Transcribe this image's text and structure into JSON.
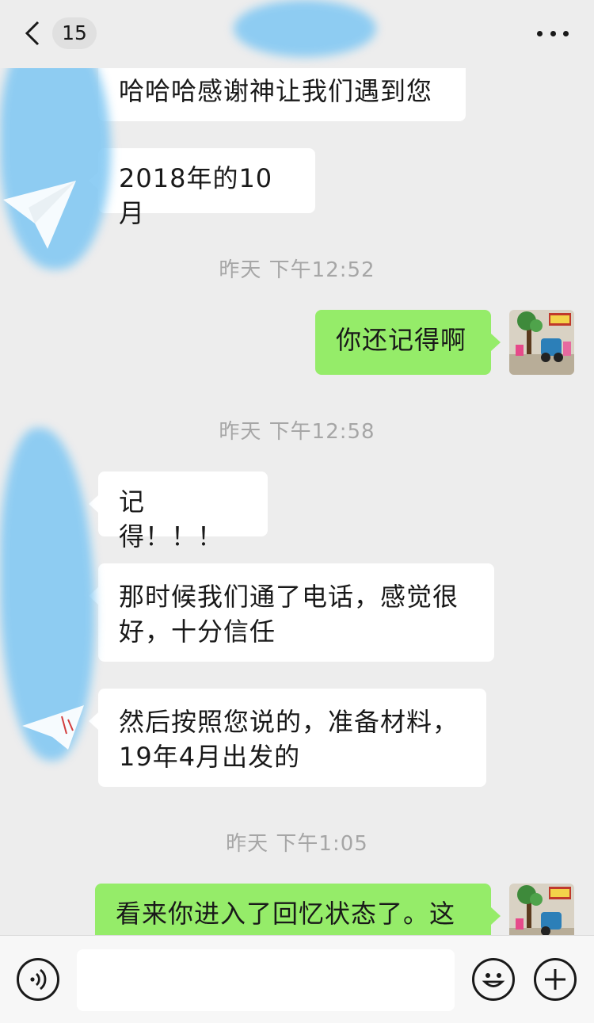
{
  "header": {
    "unread_count": "15",
    "back_icon": "chevron-left-icon",
    "more_icon": "ellipsis-icon"
  },
  "messages": [
    {
      "side": "left",
      "text": "哈哈哈感谢神让我们遇到您"
    },
    {
      "side": "left",
      "text": "2018年的10月"
    },
    {
      "type": "timestamp",
      "text": "昨天 下午12:52"
    },
    {
      "side": "right",
      "text": "你还记得啊"
    },
    {
      "type": "timestamp",
      "text": "昨天 下午12:58"
    },
    {
      "side": "left",
      "text": "记得！！！"
    },
    {
      "side": "left",
      "text": "那时候我们通了电话，感觉很好，十分信任"
    },
    {
      "side": "left",
      "text": "然后按照您说的，准备材料，19年4月出发的"
    },
    {
      "type": "timestamp",
      "text": "昨天 下午1:05"
    },
    {
      "side": "right",
      "text": "看来你进入了回忆状态了。这"
    }
  ],
  "input_bar": {
    "placeholder": "",
    "voice_icon": "voice-icon",
    "emoji_icon": "emoji-icon",
    "plus_icon": "plus-icon"
  },
  "colors": {
    "background": "#ededed",
    "outgoing_bubble": "#95ec69",
    "incoming_bubble": "#ffffff",
    "timestamp_text": "#a6a6a6"
  }
}
